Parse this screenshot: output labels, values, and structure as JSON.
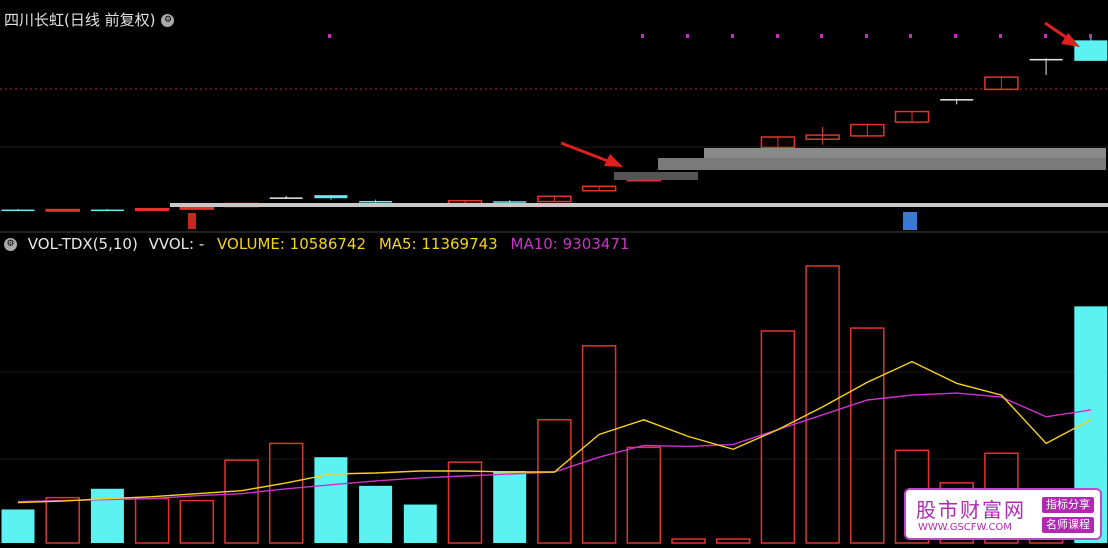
{
  "header": {
    "title": "四川长虹(日线 前复权)",
    "indicator_name": "VOL-TDX(5,10)",
    "vvol_label": "VVOL: -",
    "volume_label": "VOLUME: 10586742",
    "ma5_label": "MA5: 11369743",
    "ma10_label": "MA10: 9303471"
  },
  "colors": {
    "up": "#e0352f",
    "down": "#5cf2f2",
    "ma5": "#f5d21f",
    "ma10": "#cc33cc",
    "header_vol": "#f5d21f",
    "header_ma10": "#cc33cc",
    "arrow": "#e02020"
  },
  "chart_data": [
    {
      "type": "candlestick",
      "series": [
        {
          "o": 4.86,
          "h": 4.88,
          "l": 4.85,
          "c": 4.86,
          "dir": "down"
        },
        {
          "o": 4.83,
          "h": 4.87,
          "l": 4.82,
          "c": 4.86,
          "dir": "up"
        },
        {
          "o": 4.86,
          "h": 4.88,
          "l": 4.84,
          "c": 4.86,
          "dir": "down"
        },
        {
          "o": 4.84,
          "h": 4.9,
          "l": 4.83,
          "c": 4.89,
          "dir": "up"
        },
        {
          "o": 4.89,
          "h": 4.95,
          "l": 4.88,
          "c": 4.93,
          "dir": "up"
        },
        {
          "o": 4.97,
          "h": 5.1,
          "l": 4.96,
          "c": 5.08,
          "dir": "up"
        },
        {
          "o": 5.3,
          "h": 5.35,
          "l": 5.25,
          "c": 5.3,
          "dir": "flat"
        },
        {
          "o": 5.38,
          "h": 5.39,
          "l": 5.22,
          "c": 5.27,
          "dir": "down"
        },
        {
          "o": 5.17,
          "h": 5.22,
          "l": 5.1,
          "c": 5.13,
          "dir": "down"
        },
        {
          "o": 5.05,
          "h": 5.08,
          "l": 5.0,
          "c": 5.03,
          "dir": "down"
        },
        {
          "o": 5.08,
          "h": 5.2,
          "l": 5.06,
          "c": 5.18,
          "dir": "up"
        },
        {
          "o": 5.16,
          "h": 5.2,
          "l": 5.1,
          "c": 5.12,
          "dir": "down"
        },
        {
          "o": 5.15,
          "h": 5.36,
          "l": 5.14,
          "c": 5.34,
          "dir": "up"
        },
        {
          "o": 5.54,
          "h": 5.72,
          "l": 5.52,
          "c": 5.7,
          "dir": "up"
        },
        {
          "o": 5.9,
          "h": 6.07,
          "l": 5.88,
          "c": 6.05,
          "dir": "up"
        },
        {
          "o": 6.52,
          "h": 6.54,
          "l": 6.47,
          "c": 6.52,
          "dir": "flat"
        },
        {
          "o": 6.7,
          "h": 6.72,
          "l": 6.68,
          "c": 6.7,
          "dir": "flat"
        },
        {
          "o": 7.1,
          "h": 7.5,
          "l": 7.08,
          "c": 7.48,
          "dir": "up"
        },
        {
          "o": 7.4,
          "h": 7.85,
          "l": 7.2,
          "c": 7.55,
          "dir": "up"
        },
        {
          "o": 7.52,
          "h": 7.96,
          "l": 7.5,
          "c": 7.93,
          "dir": "up"
        },
        {
          "o": 8.02,
          "h": 8.42,
          "l": 8.0,
          "c": 8.4,
          "dir": "up"
        },
        {
          "o": 8.85,
          "h": 8.86,
          "l": 8.66,
          "c": 8.85,
          "dir": "flat"
        },
        {
          "o": 9.2,
          "h": 9.68,
          "l": 9.18,
          "c": 9.64,
          "dir": "up"
        },
        {
          "o": 10.3,
          "h": 10.32,
          "l": 9.72,
          "c": 10.3,
          "dir": "flat"
        },
        {
          "o": 10.97,
          "h": 11.1,
          "l": 10.25,
          "c": 10.23,
          "dir": "down"
        }
      ]
    },
    {
      "type": "bar",
      "title": "VOL-TDX(5,10)",
      "series": [
        {
          "name": "VOLUME",
          "values": [
            3.4,
            4.6,
            5.5,
            4.5,
            4.3,
            8.4,
            10.1,
            8.7,
            5.8,
            3.9,
            8.2,
            7.3,
            12.5,
            20.0,
            9.7,
            0.4,
            0.4,
            21.5,
            28.1,
            21.8,
            9.4,
            6.1,
            9.1,
            3.9,
            24.0
          ]
        },
        {
          "name": "MA5",
          "values": [
            4.1,
            4.25,
            4.5,
            4.7,
            5.0,
            5.3,
            6.1,
            7.0,
            7.1,
            7.3,
            7.3,
            7.2,
            7.2,
            11.0,
            12.5,
            10.8,
            9.5,
            11.5,
            13.8,
            16.3,
            18.4,
            16.2,
            15.0,
            10.1,
            12.5
          ]
        },
        {
          "name": "MA10",
          "values": [
            4.2,
            4.3,
            4.4,
            4.5,
            4.8,
            5.0,
            5.5,
            5.9,
            6.3,
            6.6,
            6.8,
            7.0,
            7.2,
            8.7,
            9.9,
            9.8,
            10.0,
            11.5,
            13.0,
            14.5,
            15.0,
            15.2,
            14.8,
            12.8,
            13.5
          ]
        }
      ]
    }
  ]
}
